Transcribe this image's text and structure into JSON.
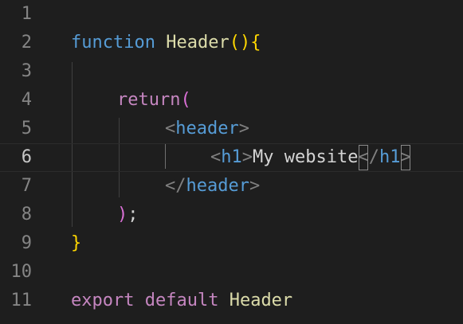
{
  "editor": {
    "colors": {
      "keyword_blue": "#569cd6",
      "control_purple": "#c586c0",
      "function_yellow": "#dcdcaa",
      "class_teal": "#4ec9b0",
      "tag_blue": "#569cd6",
      "tag_gray": "#808080",
      "brace_gold": "#ffd700",
      "brace_violet": "#da70d6",
      "brace_blue": "#179fff",
      "text": "#d4d4d4"
    },
    "lines": [
      {
        "num": "1",
        "tokens": []
      },
      {
        "num": "2",
        "tokens": [
          "function",
          " ",
          "Header",
          "()",
          "{"
        ]
      },
      {
        "num": "3",
        "tokens": []
      },
      {
        "num": "4",
        "tokens": [
          "return",
          "("
        ]
      },
      {
        "num": "5",
        "tokens": [
          "<",
          "header",
          ">"
        ]
      },
      {
        "num": "6",
        "tokens": [
          "<",
          "h1",
          ">",
          "My website",
          "<",
          "/",
          "h1",
          ">"
        ]
      },
      {
        "num": "7",
        "tokens": [
          "</",
          "header",
          ">"
        ]
      },
      {
        "num": "8",
        "tokens": [
          ")",
          ";"
        ]
      },
      {
        "num": "9",
        "tokens": [
          "}"
        ]
      },
      {
        "num": "10",
        "tokens": []
      },
      {
        "num": "11",
        "tokens": [
          "export",
          " ",
          "default",
          " ",
          "Header"
        ]
      }
    ]
  }
}
